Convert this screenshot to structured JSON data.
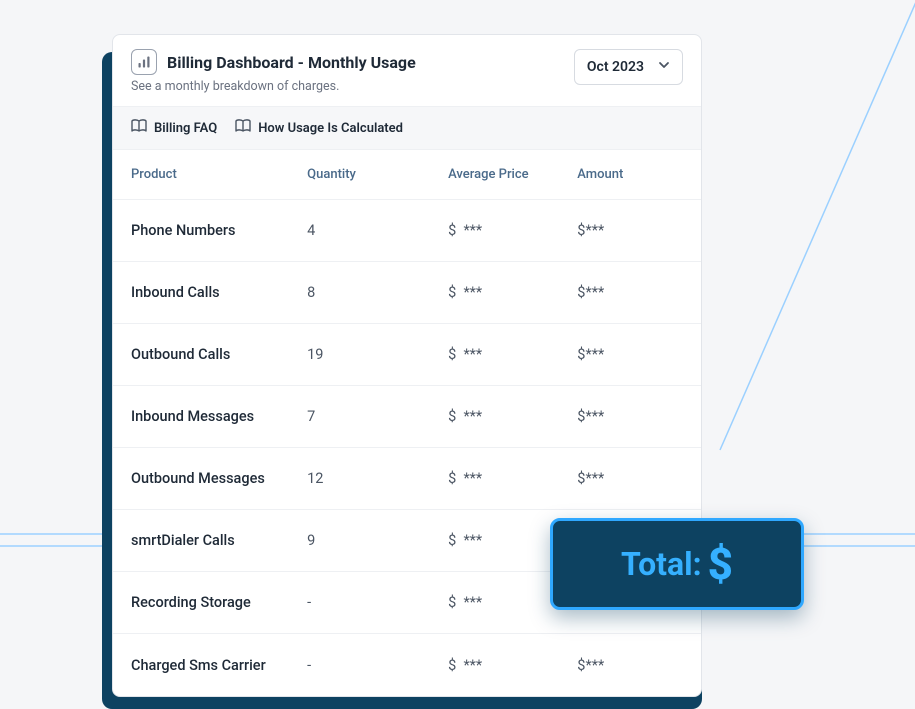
{
  "header": {
    "title": "Billing Dashboard - Monthly Usage",
    "subtitle": "See a monthly breakdown of charges.",
    "month_label": "Oct 2023"
  },
  "help_links": {
    "faq": "Billing FAQ",
    "usage": "How Usage Is Calculated"
  },
  "table": {
    "columns": {
      "product": "Product",
      "quantity": "Quantity",
      "avg_price": "Average Price",
      "amount": "Amount"
    },
    "rows": [
      {
        "product": "Phone Numbers",
        "quantity": "4",
        "avg_price": "***",
        "amount": "***"
      },
      {
        "product": "Inbound Calls",
        "quantity": "8",
        "avg_price": "***",
        "amount": "***"
      },
      {
        "product": "Outbound Calls",
        "quantity": "19",
        "avg_price": "***",
        "amount": "***"
      },
      {
        "product": "Inbound Messages",
        "quantity": "7",
        "avg_price": "***",
        "amount": "***"
      },
      {
        "product": "Outbound Messages",
        "quantity": "12",
        "avg_price": "***",
        "amount": "***"
      },
      {
        "product": "smrtDialer Calls",
        "quantity": "9",
        "avg_price": "***",
        "amount": "***"
      },
      {
        "product": "Recording Storage",
        "quantity": "-",
        "avg_price": "***",
        "amount": "***"
      },
      {
        "product": "Charged Sms Carrier",
        "quantity": "-",
        "avg_price": "***",
        "amount": "***"
      }
    ]
  },
  "total": {
    "label": "Total:",
    "currency": "$"
  },
  "colors": {
    "accent_blue": "#35b0ff",
    "dark_blue": "#0d4261",
    "bg": "#f5f6f8"
  }
}
